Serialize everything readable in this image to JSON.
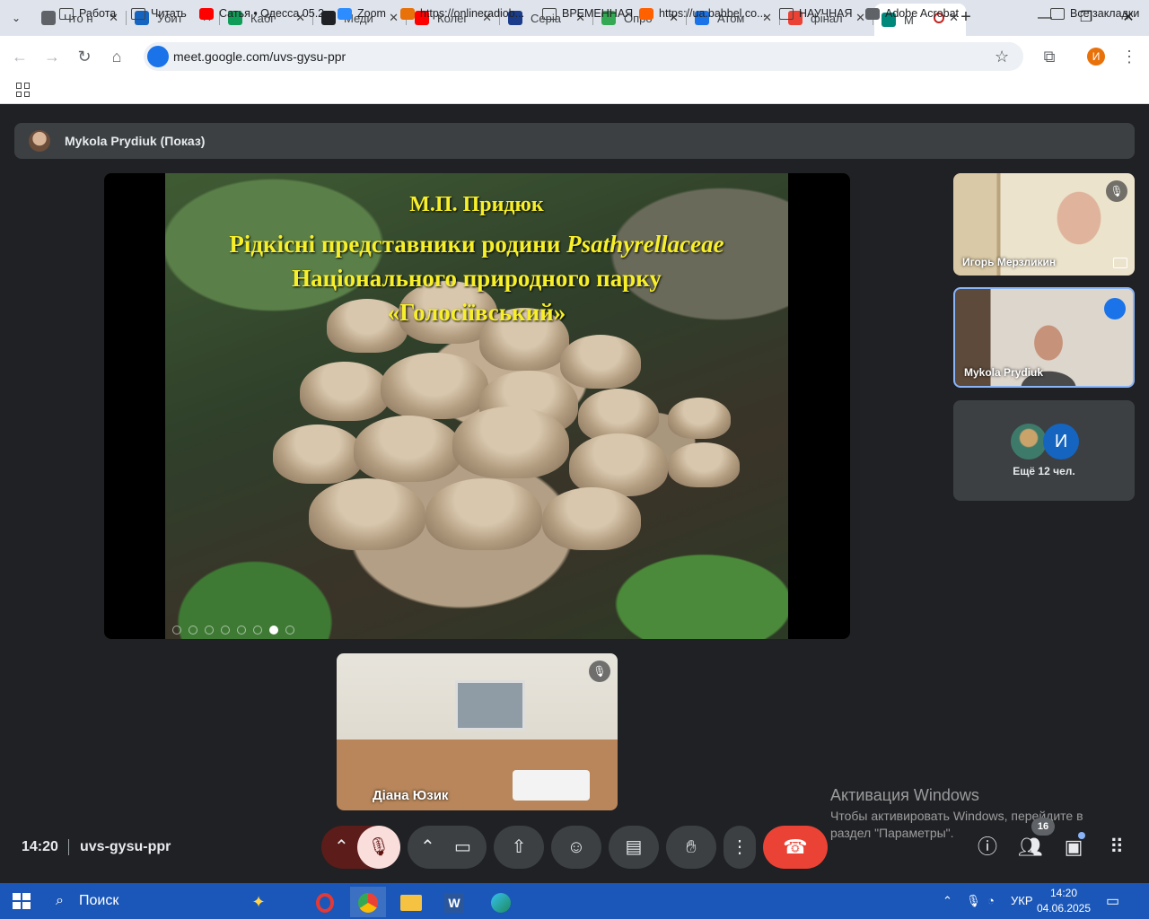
{
  "browser": {
    "tabs": [
      {
        "label": "Что н",
        "color": "#5f6368",
        "icon": "chrome-icon"
      },
      {
        "label": "Убит",
        "color": "#1565c0",
        "icon": "onedrive-icon"
      },
      {
        "label": "Кабі",
        "color": "#0f9d58",
        "icon": "cabinet-icon"
      },
      {
        "label": "Меди",
        "color": "#202124",
        "icon": "wikipedia-icon"
      },
      {
        "label": "Колег",
        "color": "#ff0000",
        "icon": "youtube-icon"
      },
      {
        "label": "Серіа",
        "color": "#1a3c8a",
        "icon": "series-icon"
      },
      {
        "label": "Опро",
        "color": "#34a853",
        "icon": "survey-icon"
      },
      {
        "label": "Атом",
        "color": "#1a73e8",
        "icon": "radio-icon"
      },
      {
        "label": "фінал",
        "color": "#ea4335",
        "icon": "gmail-icon"
      },
      {
        "label": "M",
        "color": "#00897b",
        "icon": "meet-icon",
        "active": true
      }
    ],
    "url": "meet.google.com/uvs-gysu-ppr",
    "profile_initial": "И",
    "bookmarks": [
      {
        "label": "Работа",
        "icon": "folder-icon"
      },
      {
        "label": "Читать",
        "icon": "folder-icon"
      },
      {
        "label": "Сатья • Одесса 05.2...",
        "icon": "youtube-icon"
      },
      {
        "label": "Zoom",
        "icon": "zoom-icon"
      },
      {
        "label": "https://onlineradiob...",
        "icon": "radio-icon"
      },
      {
        "label": "ВРЕМЕННАЯ",
        "icon": "folder-icon"
      },
      {
        "label": "https://ua.babbel.co...",
        "icon": "babbel-icon"
      },
      {
        "label": "НАУЧНАЯ",
        "icon": "folder-icon"
      },
      {
        "label": "Adobe Acrobat",
        "icon": "acrobat-icon"
      },
      {
        "label": "Все закладки",
        "icon": "folder-icon"
      }
    ]
  },
  "meet": {
    "presenter_label": "Mykola Prydiuk (Показ)",
    "slide": {
      "author": "М.П. Придюк",
      "line1_prefix": "Рідкісні представники родини ",
      "line1_latin": "Psathyrellaceae",
      "line2": "Національного природного парку",
      "line3": "«Голосіївський»"
    },
    "participants": [
      {
        "name": "Игорь Мерзликин",
        "muted": true
      },
      {
        "name": "Mykola Prydiuk",
        "speaking": true
      },
      {
        "name": "Діана Юзик",
        "muted": true
      }
    ],
    "more_participants": {
      "initial": "И",
      "label": "Ещё 12 чел."
    },
    "time": "14:20",
    "meeting_code": "uvs-gysu-ppr",
    "people_count": "16"
  },
  "windows": {
    "activation_title": "Активация Windows",
    "activation_text": "Чтобы активировать Windows, перейдите в раздел \"Параметры\".",
    "search_placeholder": "Поиск",
    "lang": "УКР",
    "clock_time": "14:20",
    "clock_date": "04.06.2025"
  }
}
